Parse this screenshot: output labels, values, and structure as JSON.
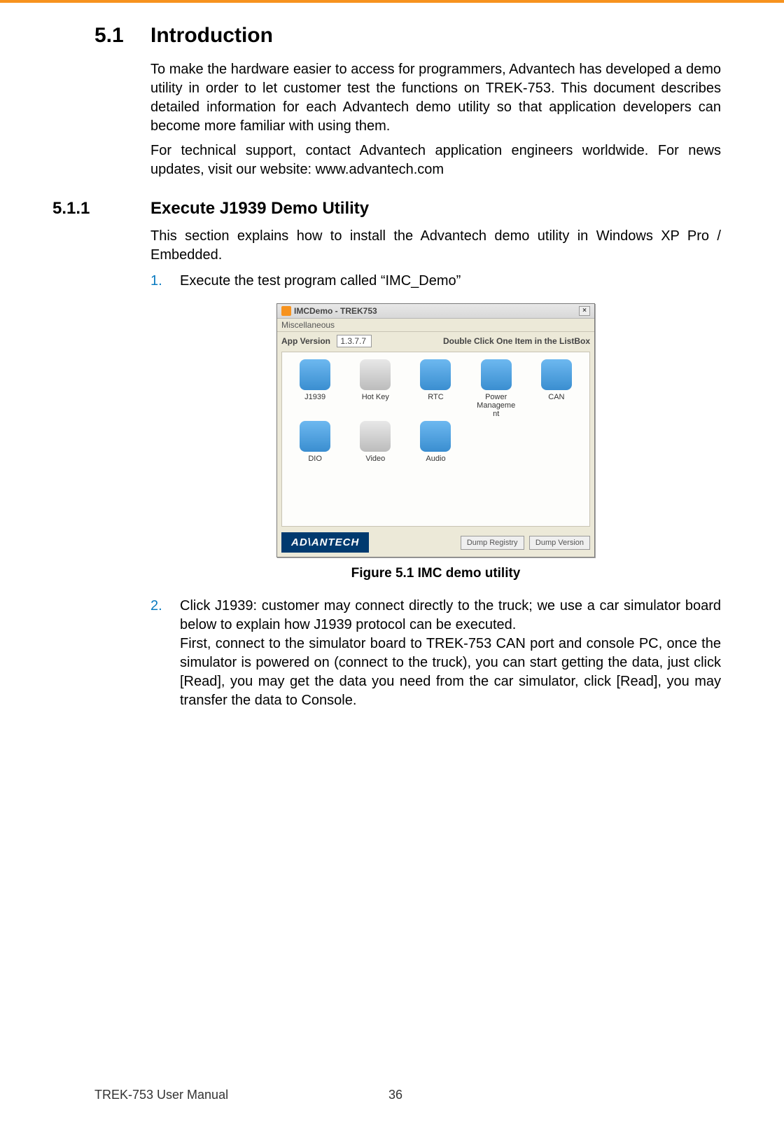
{
  "section": {
    "number": "5.1",
    "title": "Introduction"
  },
  "intro": {
    "p1": "To make the hardware easier to access for programmers, Advantech has developed a demo utility in order to let customer test the functions on TREK-753. This document describes detailed information for each Advantech demo utility so that application developers can become more familiar with using them.",
    "p2": "For technical support, contact Advantech application engineers worldwide. For news updates, visit our website: www.advantech.com"
  },
  "subsection": {
    "number": "5.1.1",
    "title": "Execute J1939 Demo Utility"
  },
  "sub_p1": "This section explains how to install the Advantech demo utility in Windows XP Pro / Embedded.",
  "steps": {
    "s1_num": "1.",
    "s1_text": "Execute the test program called “IMC_Demo”",
    "s2_num": "2.",
    "s2_text_a": "Click J1939: customer may connect directly to the truck; we use a car simulator board below to explain how J1939 protocol can be executed.",
    "s2_text_b": "First, connect to the simulator board to TREK-753 CAN port and console PC, once the simulator is powered on (connect to the truck), you can start getting the data, just click [Read], you may get the data you need from the car simulator, click [Read], you may transfer the data to Console."
  },
  "figure_caption": "Figure 5.1 IMC demo utility",
  "app": {
    "title": "IMCDemo - TREK753",
    "menu": "Miscellaneous",
    "version_label": "App Version",
    "version_value": "1.3.7.7",
    "hint": "Double Click One Item in the ListBox",
    "icons": [
      {
        "label": "J1939",
        "color": "blue"
      },
      {
        "label": "Hot Key",
        "color": "silver"
      },
      {
        "label": "RTC",
        "color": "blue"
      },
      {
        "label": "Power\nManageme\nnt",
        "color": "blue"
      },
      {
        "label": "CAN",
        "color": "blue"
      },
      {
        "label": "DIO",
        "color": "blue"
      },
      {
        "label": "Video",
        "color": "silver"
      },
      {
        "label": "Audio",
        "color": "blue"
      }
    ],
    "logo": "AD\\ANTECH",
    "btn1": "Dump Registry",
    "btn2": "Dump Version"
  },
  "footer": {
    "manual": "TREK-753 User Manual",
    "page": "36"
  }
}
